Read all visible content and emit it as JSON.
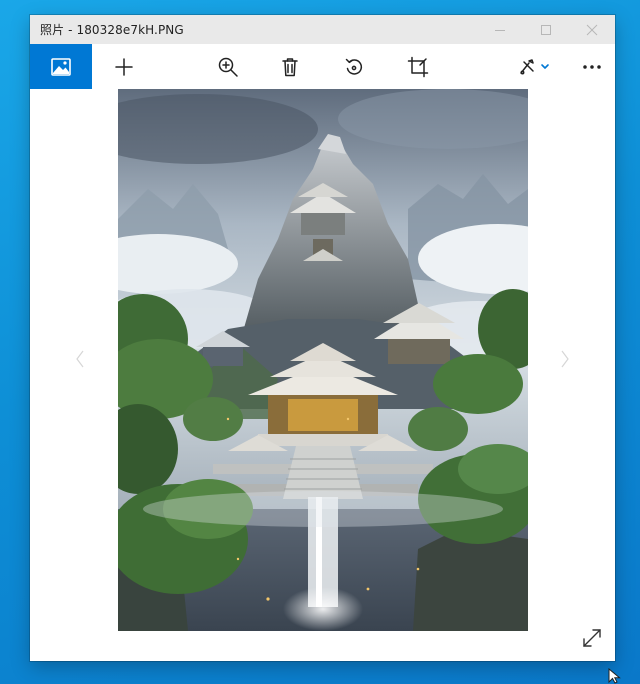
{
  "window": {
    "title": "照片 - 180328e7kH.PNG"
  },
  "toolbar": {
    "items": [
      {
        "name": "photos-home",
        "icon": "picture-icon"
      },
      {
        "name": "add",
        "icon": "plus-icon"
      },
      {
        "name": "zoom",
        "icon": "zoom-in-icon"
      },
      {
        "name": "delete",
        "icon": "trash-icon"
      },
      {
        "name": "rotate",
        "icon": "rotate-icon"
      },
      {
        "name": "crop",
        "icon": "crop-icon"
      },
      {
        "name": "edit",
        "icon": "draw-icon"
      },
      {
        "name": "more",
        "icon": "more-icon"
      }
    ]
  },
  "colors": {
    "accent": "#0078d4",
    "titlebar": "#e9e9e9",
    "desktop": "#0e8fd6"
  },
  "viewer": {
    "image_subject": "fantasy mountain temple with waterfall"
  }
}
